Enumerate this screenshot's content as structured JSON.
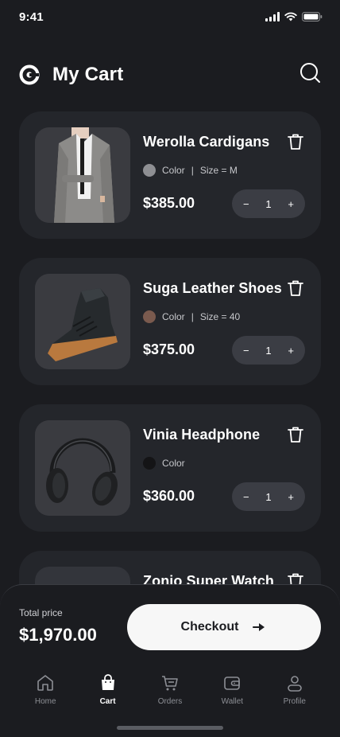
{
  "status_bar": {
    "time": "9:41"
  },
  "header": {
    "title": "My Cart",
    "logo_icon": "logo-icon",
    "search_icon": "search-icon"
  },
  "cart": {
    "items": [
      {
        "name": "Werolla Cardigans",
        "color_label": "Color",
        "color_hex": "#8e8f93",
        "size": "Size = M",
        "price": "$385.00",
        "quantity": "1"
      },
      {
        "name": "Suga Leather Shoes",
        "color_label": "Color",
        "color_hex": "#7a5a4e",
        "size": "Size = 40",
        "price": "$375.00",
        "quantity": "1"
      },
      {
        "name": "Vinia Headphone",
        "color_label": "Color",
        "color_hex": "#141416",
        "size": "",
        "price": "$360.00",
        "quantity": "1"
      },
      {
        "name": "Zonio Super Watch",
        "color_label": "",
        "color_hex": "",
        "size": "",
        "price": "",
        "quantity": ""
      }
    ],
    "minus": "−",
    "plus": "+",
    "separator": "|"
  },
  "summary": {
    "total_label": "Total price",
    "total_value": "$1,970.00",
    "checkout_label": "Checkout"
  },
  "tabbar": {
    "items": [
      {
        "label": "Home",
        "icon": "home-icon"
      },
      {
        "label": "Cart",
        "icon": "shopping-bag-icon"
      },
      {
        "label": "Orders",
        "icon": "orders-cart-icon"
      },
      {
        "label": "Wallet",
        "icon": "wallet-icon"
      },
      {
        "label": "Profile",
        "icon": "profile-icon"
      }
    ],
    "active": "Cart"
  },
  "colors": {
    "background": "#1b1c20",
    "card": "#24262b",
    "thumb": "#33353b",
    "stepper": "#3b3d44",
    "button": "#f7f7f7"
  }
}
